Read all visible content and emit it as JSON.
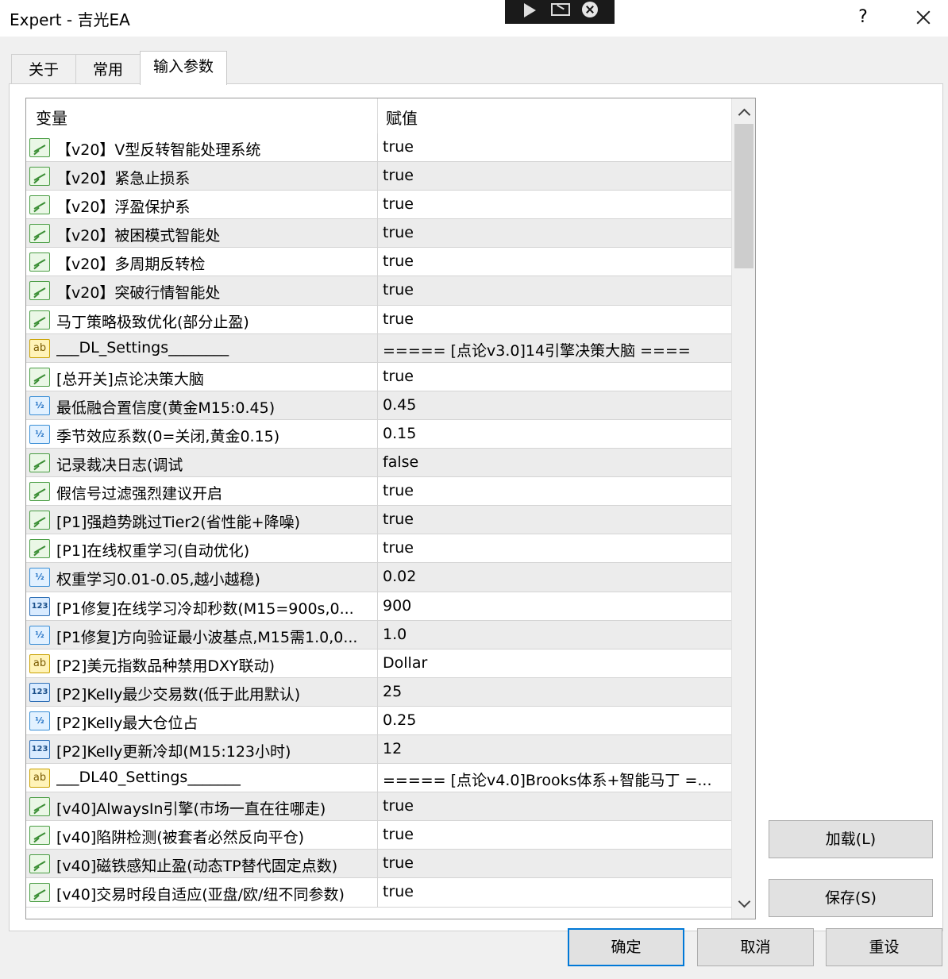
{
  "window": {
    "title": "Expert - 吉光EA",
    "help_label": "?",
    "overlay_icons": [
      "play-icon",
      "expand-icon",
      "close-circle-icon"
    ]
  },
  "tabs": [
    {
      "label": "关于",
      "active": false
    },
    {
      "label": "常用",
      "active": false
    },
    {
      "label": "输入参数",
      "active": true
    }
  ],
  "grid": {
    "col_variable": "变量",
    "col_value": "赋值",
    "rows": [
      {
        "type": "bool",
        "name": "【v20】V型反转智能处理系统",
        "value": "true"
      },
      {
        "type": "bool",
        "name": "【v20】紧急止损系",
        "value": "true"
      },
      {
        "type": "bool",
        "name": "【v20】浮盈保护系",
        "value": "true"
      },
      {
        "type": "bool",
        "name": "【v20】被困模式智能处",
        "value": "true"
      },
      {
        "type": "bool",
        "name": "【v20】多周期反转检",
        "value": "true"
      },
      {
        "type": "bool",
        "name": "【v20】突破行情智能处",
        "value": "true"
      },
      {
        "type": "bool",
        "name": "马丁策略极致优化(部分止盈)",
        "value": "true"
      },
      {
        "type": "text",
        "name": "___DL_Settings________",
        "value": "===== [点论v3.0]14引擎决策大脑 ===="
      },
      {
        "type": "bool",
        "name": "[总开关]点论决策大脑",
        "value": "true"
      },
      {
        "type": "dbl",
        "name": "最低融合置信度(黄金M15:0.45)",
        "value": "0.45"
      },
      {
        "type": "dbl",
        "name": "季节效应系数(0=关闭,黄金0.15)",
        "value": "0.15"
      },
      {
        "type": "bool",
        "name": "记录裁决日志(调试",
        "value": "false"
      },
      {
        "type": "bool",
        "name": "假信号过滤强烈建议开启",
        "value": "true"
      },
      {
        "type": "bool",
        "name": "[P1]强趋势跳过Tier2(省性能+降噪)",
        "value": "true"
      },
      {
        "type": "bool",
        "name": "[P1]在线权重学习(自动优化)",
        "value": "true"
      },
      {
        "type": "dbl",
        "name": "权重学习0.01-0.05,越小越稳)",
        "value": "0.02"
      },
      {
        "type": "int",
        "name": "[P1修复]在线学习冷却秒数(M15=900s,0...",
        "value": "900"
      },
      {
        "type": "dbl",
        "name": "[P1修复]方向验证最小波基点,M15需1.0,0...",
        "value": "1.0"
      },
      {
        "type": "text",
        "name": "[P2]美元指数品种禁用DXY联动)",
        "value": "Dollar"
      },
      {
        "type": "int",
        "name": "[P2]Kelly最少交易数(低于此用默认)",
        "value": "25"
      },
      {
        "type": "dbl",
        "name": "[P2]Kelly最大仓位占",
        "value": "0.25"
      },
      {
        "type": "int",
        "name": "[P2]Kelly更新冷却(M15:123小时)",
        "value": "12"
      },
      {
        "type": "text",
        "name": "___DL40_Settings_______",
        "value": "===== [点论v4.0]Brooks体系+智能马丁 =..."
      },
      {
        "type": "bool",
        "name": "[v40]AlwaysIn引擎(市场一直在往哪走)",
        "value": "true"
      },
      {
        "type": "bool",
        "name": "[v40]陷阱检测(被套者必然反向平仓)",
        "value": "true"
      },
      {
        "type": "bool",
        "name": "[v40]磁铁感知止盈(动态TP替代固定点数)",
        "value": "true"
      },
      {
        "type": "bool",
        "name": "[v40]交易时段自适应(亚盘/欧/纽不同参数)",
        "value": "true"
      }
    ]
  },
  "buttons": {
    "load": "加载(L)",
    "save": "保存(S)",
    "ok": "确定",
    "cancel": "取消",
    "reset": "重设"
  },
  "icons": {
    "bool": "bool-param-icon",
    "text": "ab",
    "dbl": "½",
    "int": "123"
  }
}
